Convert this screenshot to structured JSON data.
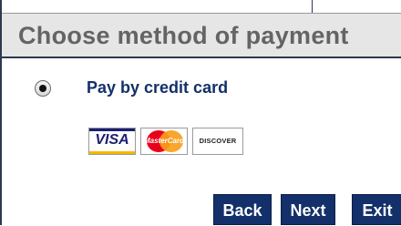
{
  "header": {
    "title": "Choose method of payment"
  },
  "payment_option": {
    "label": "Pay by credit card",
    "selected": true
  },
  "card_logos": {
    "visa": "VISA",
    "mastercard": "MasterCard",
    "discover": "DISCOVER"
  },
  "buttons": {
    "back": "Back",
    "next": "Next",
    "exit": "Exit"
  },
  "colors": {
    "primary_navy": "#13306a",
    "header_bg": "#e6e6e6",
    "header_text": "#646464"
  }
}
